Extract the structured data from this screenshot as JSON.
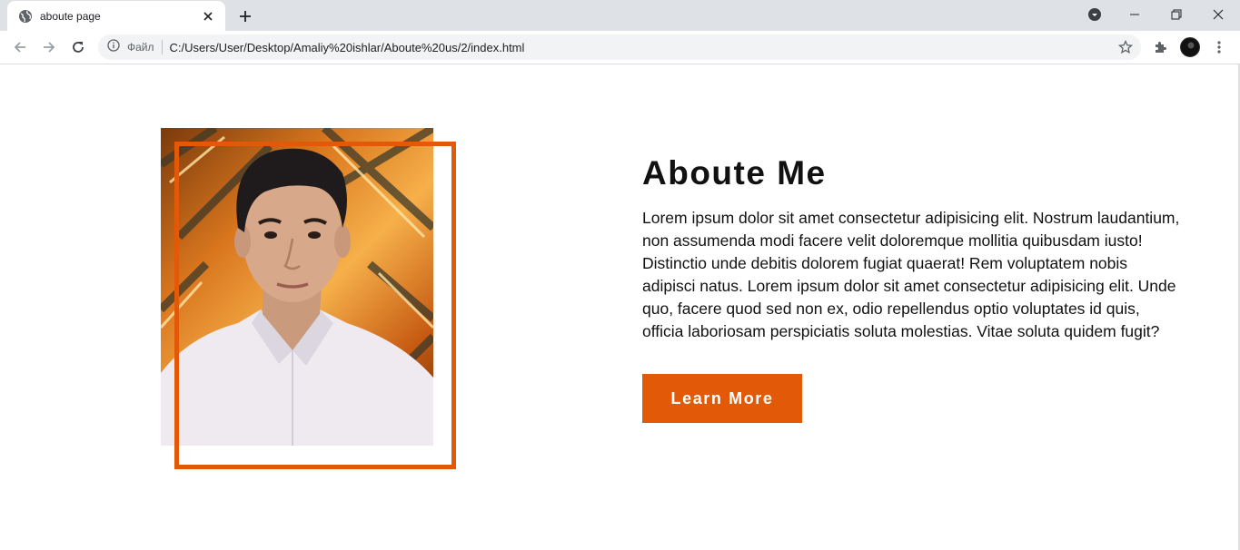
{
  "browser": {
    "tab_title": "aboute page",
    "site_label": "Файл",
    "url": "C:/Users/User/Desktop/Amaliy%20ishlar/Aboute%20us/2/index.html",
    "icons": {
      "favicon": "globe-icon",
      "tab_close": "close-icon",
      "new_tab": "plus-icon",
      "back": "arrow-left-icon",
      "forward": "arrow-right-icon",
      "reload": "reload-icon",
      "site_info": "info-icon",
      "bookmark": "star-icon",
      "extensions": "puzzle-icon",
      "menu": "kebab-menu-icon",
      "profile_dropdown": "chevron-down-icon",
      "minimize": "minimize-icon",
      "restore": "restore-icon",
      "close_window": "close-icon"
    }
  },
  "about": {
    "title": "Aboute Me",
    "text": "Lorem ipsum dolor sit amet consectetur adipisicing elit. Nostrum laudantium, non assumenda modi facere velit doloremque mollitia quibusdam iusto! Distinctio unde debitis dolorem fugiat quaerat! Rem voluptatem nobis adipisci natus. Lorem ipsum dolor sit amet consectetur adipisicing elit. Unde quo, facere quod sed non ex, odio repellendus optio voluptates id quis, officia laboriosam perspiciatis soluta molestias. Vitae soluta quidem fugit?",
    "button_label": "Learn More"
  },
  "colors": {
    "accent": "#e25a07",
    "text": "#111111"
  }
}
